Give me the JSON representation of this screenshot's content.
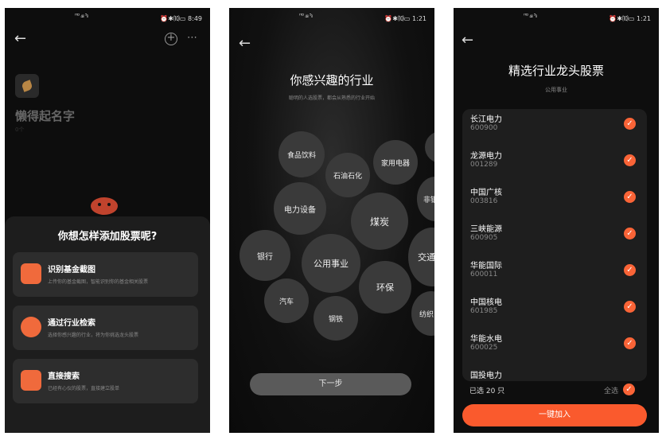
{
  "screen1": {
    "status": {
      "carrier": "ᴴᴰ ₄ᵢₗ ⁵ᵢₗ",
      "right": "⏰✱⑽▭ 8:49"
    },
    "icons": {
      "back": "←",
      "add": "+",
      "more": "⋯"
    },
    "profile": {
      "name": "懒得起名字",
      "sub": "0个"
    },
    "sheet": {
      "title": "你想怎样添加股票呢?",
      "options": [
        {
          "title": "识别基金截图",
          "desc": "上传你的基金截图，智能识别你的基金相关股票",
          "icon": "chart-icon",
          "color": "#f06a3c"
        },
        {
          "title": "通过行业检索",
          "desc": "选择你感兴趣的行业，将为你挑选龙头股票",
          "icon": "target-icon",
          "color": "#f06a3c"
        },
        {
          "title": "直接搜索",
          "desc": "已经有心仪的股票，直接建立股单",
          "icon": "search-doc-icon",
          "color": "#f06a3c"
        }
      ]
    }
  },
  "screen2": {
    "status": {
      "carrier": "ᴴᴰ ₄ᵢₗ ⁵ᵢₗ",
      "right": "⏰✱⑽▭ 1:21"
    },
    "title": "你感兴趣的行业",
    "subtitle": "聪明的人选股票，都会从熟悉的行业开始",
    "industries": [
      "食品饮料",
      "石油石化",
      "家用电器",
      "电力设备",
      "煤炭",
      "非银",
      "银行",
      "公用事业",
      "交通",
      "汽车",
      "环保",
      "钢铁",
      "纺织"
    ],
    "next_label": "下一步"
  },
  "screen3": {
    "status": {
      "carrier": "ᴴᴰ ₄ᵢₗ ⁵ᵢₗ",
      "right": "⏰✱⑽▭ 1:21"
    },
    "title": "精选行业龙头股票",
    "subtitle": "公用事业",
    "stocks": [
      {
        "name": "长江电力",
        "code": "600900"
      },
      {
        "name": "龙源电力",
        "code": "001289"
      },
      {
        "name": "中国广核",
        "code": "003816"
      },
      {
        "name": "三峡能源",
        "code": "600905"
      },
      {
        "name": "华能国际",
        "code": "600011"
      },
      {
        "name": "中国核电",
        "code": "601985"
      },
      {
        "name": "华能水电",
        "code": "600025"
      },
      {
        "name": "国投电力",
        "code": ""
      }
    ],
    "selected_label": "已选 20 只",
    "select_all_label": "全选",
    "add_label": "一键加入",
    "check": "✓",
    "accent": "#fa5a2d"
  }
}
